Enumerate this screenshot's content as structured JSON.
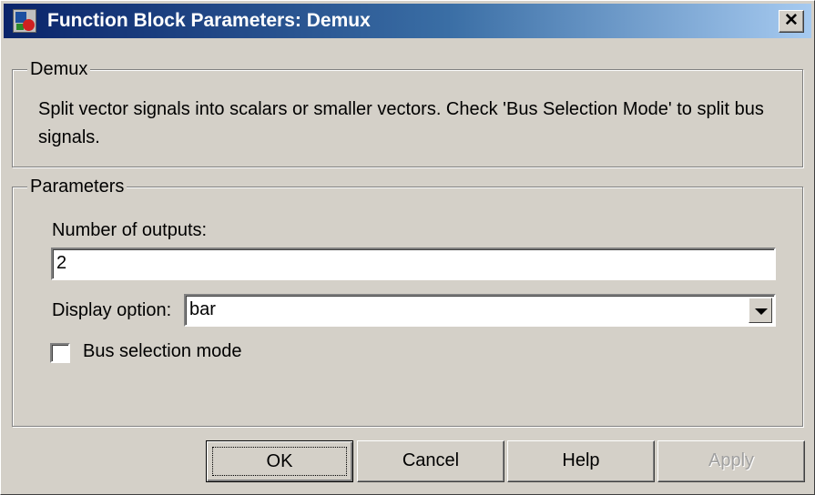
{
  "window": {
    "title": "Function Block Parameters: Demux",
    "close_label": "✕"
  },
  "demux_group": {
    "title": "Demux",
    "description": "Split vector signals into scalars or smaller vectors. Check 'Bus Selection Mode' to split bus signals."
  },
  "parameters_group": {
    "title": "Parameters",
    "num_outputs_label": "Number of outputs:",
    "num_outputs_value": "2",
    "display_option_label": "Display option:",
    "display_option_value": "bar",
    "bus_selection_label": "Bus selection mode",
    "bus_selection_checked": false
  },
  "buttons": {
    "ok": "OK",
    "cancel": "Cancel",
    "help": "Help",
    "apply": "Apply"
  },
  "icons": {
    "app": "simulink-block-icon",
    "close": "close-icon",
    "dropdown": "chevron-down-icon"
  }
}
